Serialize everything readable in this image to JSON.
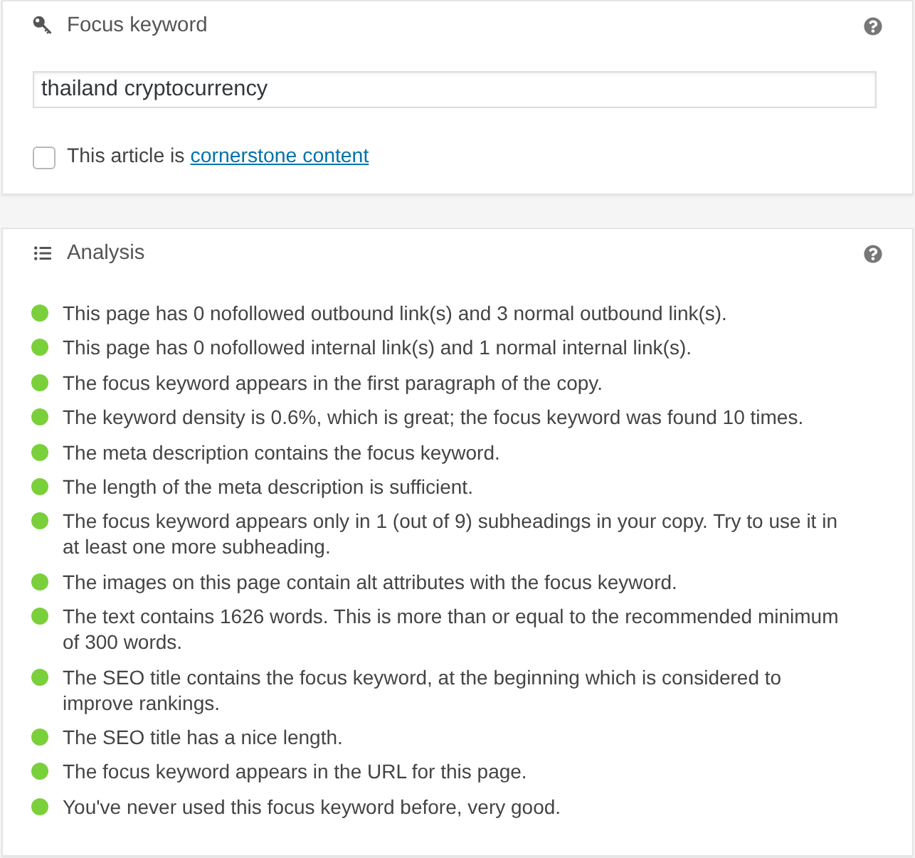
{
  "focus_keyword_panel": {
    "title": "Focus keyword",
    "keyword_field": {
      "value": "thailand cryptocurrency"
    },
    "cornerstone": {
      "label": "This article is",
      "link": "cornerstone content",
      "checked": false
    }
  },
  "analysis_panel": {
    "title": "Analysis",
    "items": [
      {
        "color": "#7ad03a",
        "text": "This page has 0 nofollowed outbound link(s) and 3 normal outbound link(s)."
      },
      {
        "color": "#7ad03a",
        "text": "This page has 0 nofollowed internal link(s) and 1 normal internal link(s)."
      },
      {
        "color": "#7ad03a",
        "text": "The focus keyword appears in the first paragraph of the copy."
      },
      {
        "color": "#7ad03a",
        "text": "The keyword density is 0.6%, which is great; the focus keyword was found 10 times."
      },
      {
        "color": "#7ad03a",
        "text": "The meta description contains the focus keyword."
      },
      {
        "color": "#7ad03a",
        "text": "The length of the meta description is sufficient."
      },
      {
        "color": "#7ad03a",
        "text": "The focus keyword appears only in 1 (out of 9) subheadings in your copy. Try to use it in at least one more subheading."
      },
      {
        "color": "#7ad03a",
        "text": "The images on this page contain alt attributes with the focus keyword."
      },
      {
        "color": "#7ad03a",
        "text": "The text contains 1626 words. This is more than or equal to the recommended minimum of 300 words."
      },
      {
        "color": "#7ad03a",
        "text": "The SEO title contains the focus keyword, at the beginning which is considered to improve rankings."
      },
      {
        "color": "#7ad03a",
        "text": "The SEO title has a nice length."
      },
      {
        "color": "#7ad03a",
        "text": "The focus keyword appears in the URL for this page."
      },
      {
        "color": "#7ad03a",
        "text": "You've never used this focus keyword before, very good."
      }
    ]
  }
}
